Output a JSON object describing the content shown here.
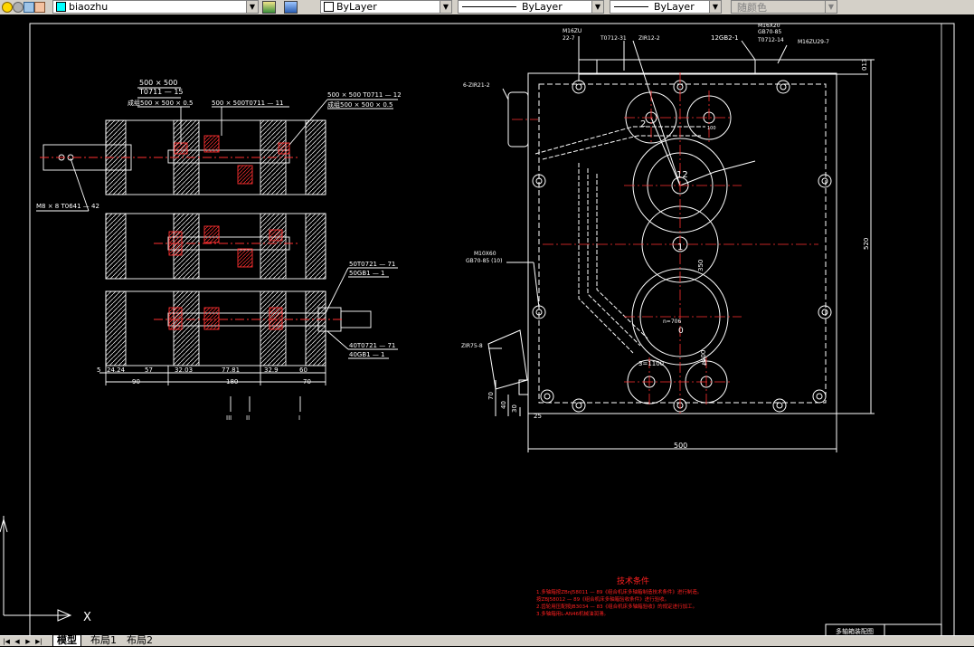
{
  "toolbar": {
    "layer_name": "biaozhu",
    "color_control": "ByLayer",
    "linetype_control": "ByLayer",
    "lineweight_control": "ByLayer",
    "plotstyle_control": "随颜色"
  },
  "tabs": [
    {
      "label": "模型"
    },
    {
      "label": "布局1"
    },
    {
      "label": "布局2"
    }
  ],
  "ucs": {
    "x_label": "X"
  },
  "left_drawing": {
    "labels": {
      "a": "500 × 500",
      "b": "T0711 — 15",
      "c": "成组500 × 500 × 0.5",
      "d": "500 × 500T0711 — 11",
      "e": "500 × 500 T0711 — 12",
      "f": "成组500 × 500 × 0.5",
      "g": "M8 × 8 T0641 — 42",
      "h": "50T0721 — 71",
      "i": "50GB1 — 1",
      "j": "40T0721 — 71",
      "k": "40GB1 — 1"
    },
    "dims_top": [
      "5",
      "24.24",
      "57",
      "32.03",
      "77.81",
      "32.9",
      "60"
    ],
    "dims_bottom": [
      "90",
      "180",
      "70"
    ],
    "shafts": [
      "III",
      "II",
      "I"
    ]
  },
  "right_drawing": {
    "labels": {
      "m16": "M16ZU",
      "m16b": "22-7",
      "t0712": "T0712-31",
      "zr": "ZIR12-2",
      "gb": "12GB2-1",
      "m16x20": "M16X20",
      "gb70": "GB70-85",
      "t0712b": "T0712-14",
      "m16zu": "M16ZU29-7",
      "side": "6-ZIR21-2",
      "m10": "M10X60",
      "gb580": "GB70-85 (10)",
      "zir75": "ZIR75-8",
      "n2": "2",
      "n12": "12",
      "n1": "1",
      "n3": "3=1100",
      "n706": "n=706",
      "n_o": "0",
      "n4": "4",
      "d100": "100",
      "d350": "350",
      "d400": "400"
    },
    "dims": {
      "width": "500",
      "height": "520",
      "d70": "70",
      "d40": "40",
      "d30": "30",
      "d25": "25",
      "d13": "013"
    }
  },
  "notes": {
    "title": "技术条件",
    "lines": [
      "1.多轴箱按ZBnJ58011 — 89《组合机床多轴箱制造技术条件》进行制造。",
      "   按ZBJ58012 — 89《组合机床多轴箱验收条件》进行验收。",
      "2.齿轮用压配按JB3034 — 83《组合机床多轴箱验收》的规定进行加工。",
      "3.多轴箱用L-AN46机械油润滑。"
    ]
  },
  "title_block": {
    "text": "多轴箱装配图"
  },
  "colors": {
    "toolbar": "#d4d0c8",
    "canvas": "#000000",
    "line": "#ffffff",
    "accent": "#ff0000"
  }
}
